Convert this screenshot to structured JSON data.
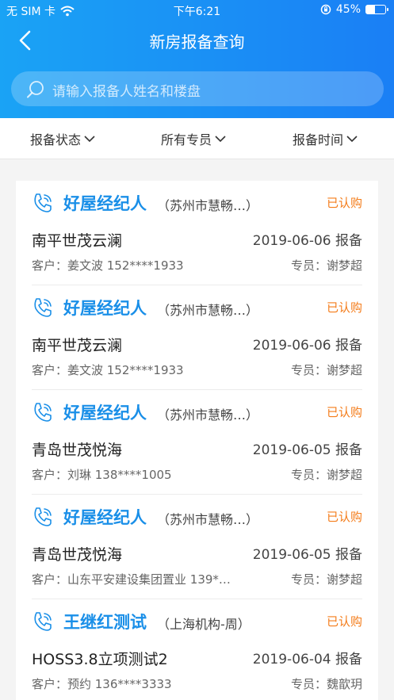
{
  "status_bar": {
    "carrier": "无 SIM 卡",
    "time": "下午6:21",
    "battery": "45%",
    "battery_level": 0.45
  },
  "nav": {
    "title": "新房报备查询"
  },
  "search": {
    "placeholder": "请输入报备人姓名和楼盘"
  },
  "filters": [
    "报备状态",
    "所有专员",
    "报备时间"
  ],
  "records": [
    {
      "agent": "好屋经纪人",
      "agency": "（苏州市慧畅…）",
      "status": "已认购",
      "project": "南平世茂云澜",
      "date": "2019-06-06 报备",
      "customer": "客户：姜文波 152****1933",
      "staff": "专员：谢梦超"
    },
    {
      "agent": "好屋经纪人",
      "agency": "（苏州市慧畅…）",
      "status": "已认购",
      "project": "南平世茂云澜",
      "date": "2019-06-06 报备",
      "customer": "客户：姜文波 152****1933",
      "staff": "专员：谢梦超"
    },
    {
      "agent": "好屋经纪人",
      "agency": "（苏州市慧畅…）",
      "status": "已认购",
      "project": "青岛世茂悦海",
      "date": "2019-06-05 报备",
      "customer": "客户：刘琳 138****1005",
      "staff": "专员：谢梦超"
    },
    {
      "agent": "好屋经纪人",
      "agency": "（苏州市慧畅…）",
      "status": "已认购",
      "project": "青岛世茂悦海",
      "date": "2019-06-05 报备",
      "customer": "客户：山东平安建设集团置业 139*…",
      "staff": "专员：谢梦超"
    },
    {
      "agent": "王继红测试",
      "agency": "（上海机构-周）",
      "status": "已认购",
      "project": "HOSS3.8立项测试2",
      "date": "2019-06-04 报备",
      "customer": "客户：预约 136****3333",
      "staff": "专员：魏歆玥"
    }
  ]
}
